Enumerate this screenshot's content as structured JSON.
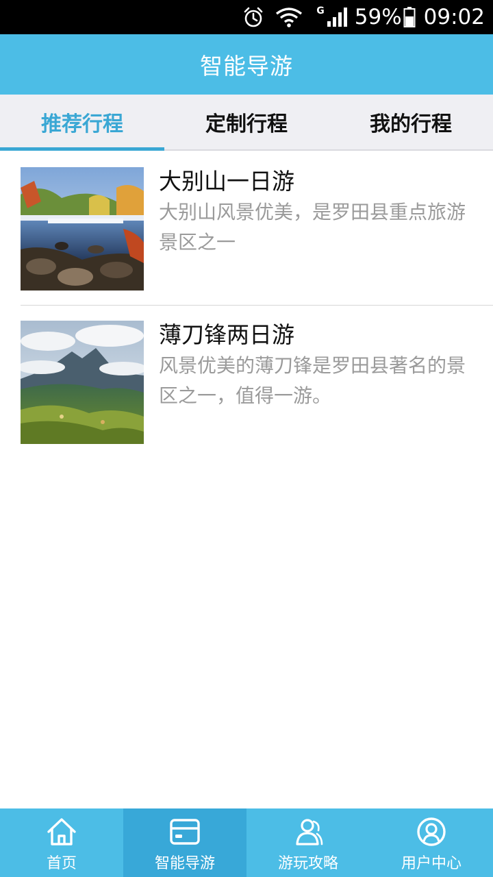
{
  "status_bar": {
    "network_type": "G",
    "battery": "59%",
    "time": "09:02"
  },
  "header": {
    "title": "智能导游"
  },
  "tabs": [
    {
      "label": "推荐行程",
      "active": true
    },
    {
      "label": "定制行程",
      "active": false
    },
    {
      "label": "我的行程",
      "active": false
    }
  ],
  "trips": [
    {
      "title": "大别山一日游",
      "description": "大别山风景优美，是罗田县重点旅游景区之一",
      "image_icon": "landscape-river-photo"
    },
    {
      "title": "薄刀锋两日游",
      "description": "风景优美的薄刀锋是罗田县著名的景区之一，值得一游。",
      "image_icon": "landscape-mountain-photo"
    }
  ],
  "bottom_nav": [
    {
      "label": "首页",
      "icon": "home-icon",
      "active": false
    },
    {
      "label": "智能导游",
      "icon": "card-icon",
      "active": true
    },
    {
      "label": "游玩攻略",
      "icon": "people-icon",
      "active": false
    },
    {
      "label": "用户中心",
      "icon": "user-icon",
      "active": false
    }
  ],
  "colors": {
    "accent": "#4cbde6",
    "accent_dark": "#38a8d8",
    "tab_active": "#3aa7d4"
  }
}
